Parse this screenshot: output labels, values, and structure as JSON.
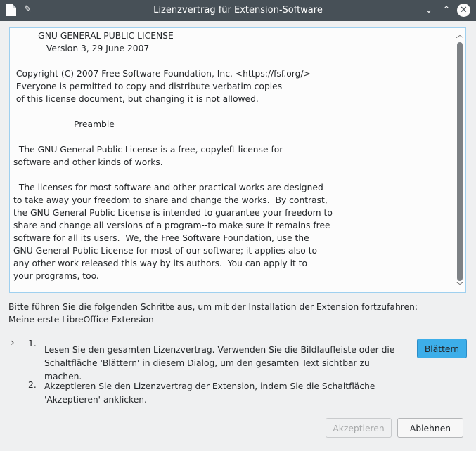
{
  "window": {
    "title": "Lizenzvertrag für Extension-Software",
    "controls": {
      "minimize": "⌄",
      "maximize": "⌃",
      "close": "✕"
    }
  },
  "license": {
    "text": "         GNU GENERAL PUBLIC LICENSE\n            Version 3, 29 June 2007\n\n Copyright (C) 2007 Free Software Foundation, Inc. <https://fsf.org/>\n Everyone is permitted to copy and distribute verbatim copies\n of this license document, but changing it is not allowed.\n\n                      Preamble\n\n  The GNU General Public License is a free, copyleft license for\nsoftware and other kinds of works.\n\n  The licenses for most software and other practical works are designed\nto take away your freedom to share and change the works.  By contrast,\nthe GNU General Public License is intended to guarantee your freedom to\nshare and change all versions of a program--to make sure it remains free\nsoftware for all its users.  We, the Free Software Foundation, use the\nGNU General Public License for most of our software; it applies also to\nany other work released this way by its authors.  You can apply it to\nyour programs, too."
  },
  "instructions": {
    "line1": "Bitte führen Sie die folgenden Schritte aus, um mit der Installation der Extension fortzufahren:",
    "line2": "Meine erste LibreOffice Extension"
  },
  "steps": [
    {
      "number": "1.",
      "text": "Lesen Sie den gesamten Lizenzvertrag. Verwenden Sie die Bildlaufleiste oder die Schaltfläche 'Blättern' in diesem Dialog, um den gesamten Text sichtbar zu machen."
    },
    {
      "number": "2.",
      "text": "Akzeptieren Sie den Lizenzvertrag der Extension, indem Sie die Schaltfläche 'Akzeptieren' anklicken."
    }
  ],
  "buttons": {
    "scroll": "Blättern",
    "accept": "Akzeptieren",
    "decline": "Ablehnen"
  },
  "colors": {
    "accent": "#3daee9",
    "titlebar": "#475057"
  }
}
